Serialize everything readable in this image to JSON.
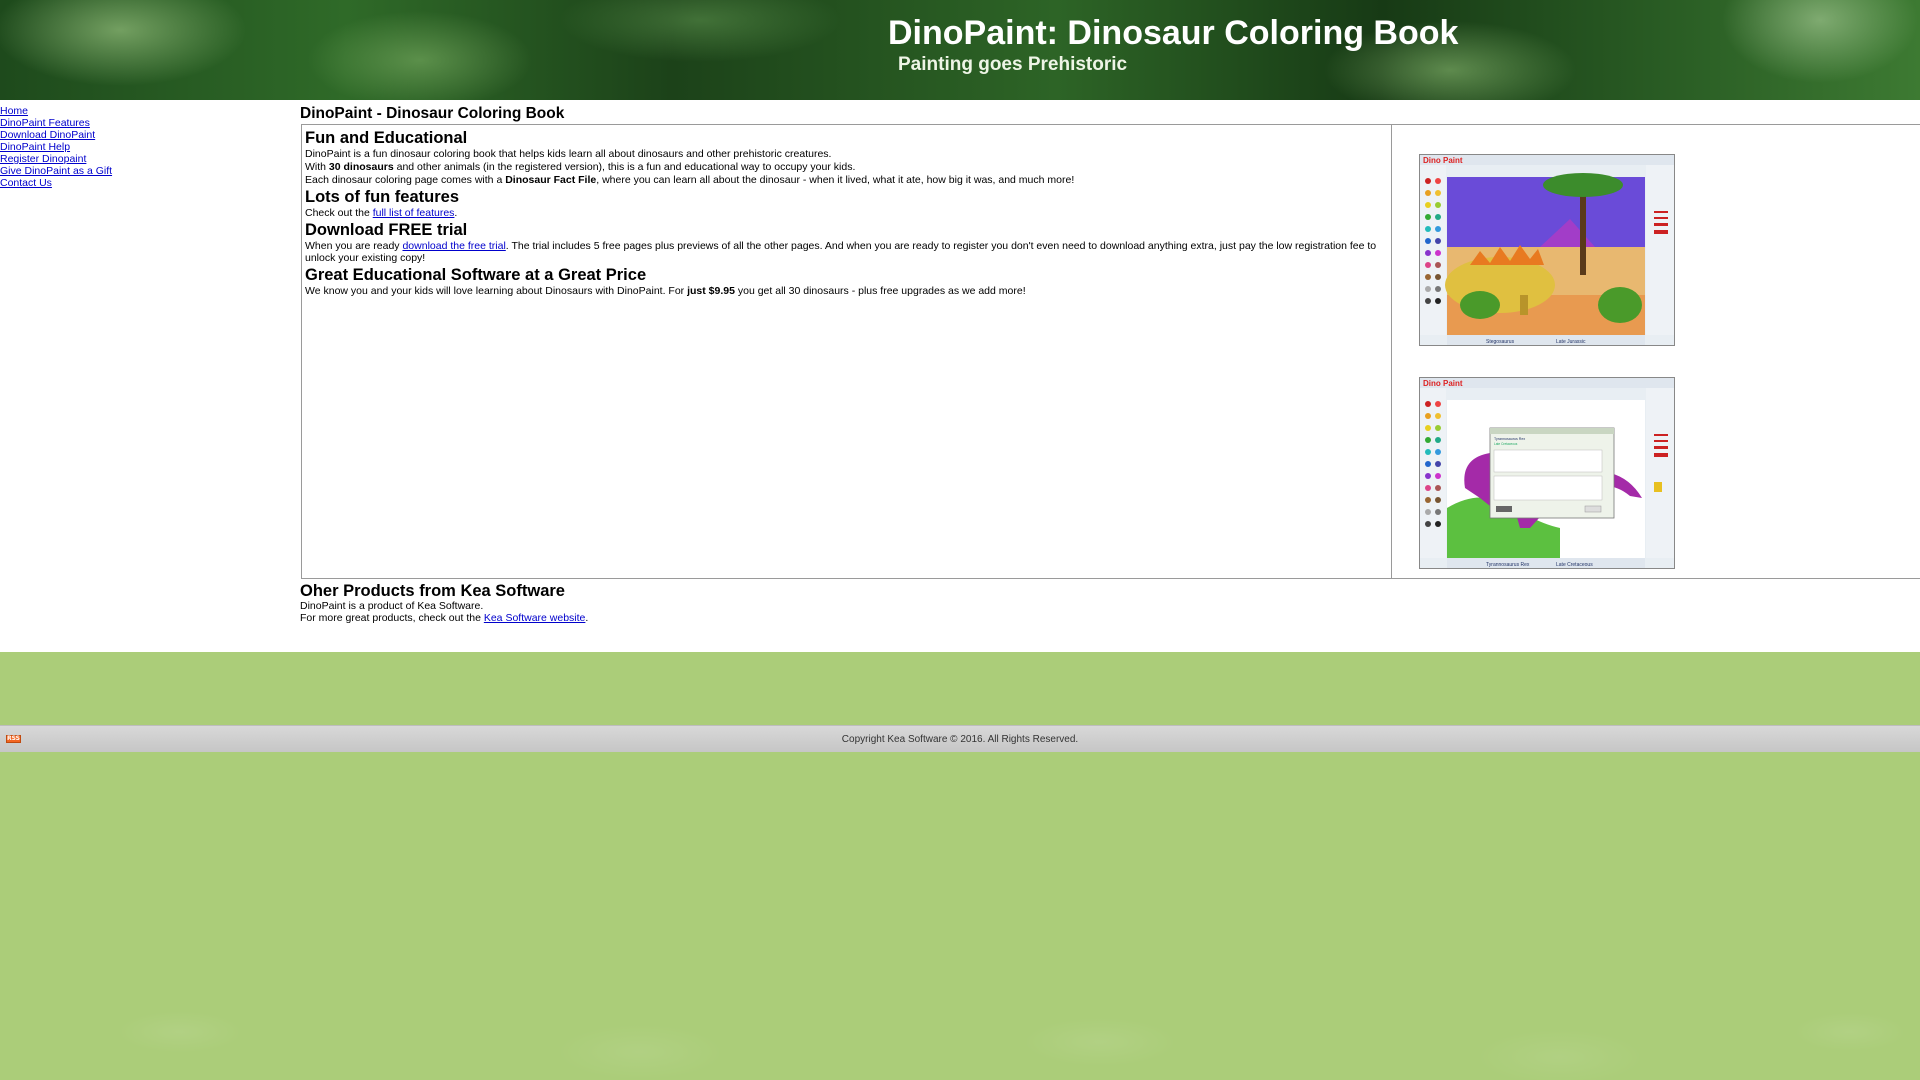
{
  "header": {
    "title": "DinoPaint: Dinosaur Coloring Book",
    "subtitle": "Painting goes Prehistoric"
  },
  "sidebar": {
    "items": [
      {
        "label": "Home"
      },
      {
        "label": "DinoPaint Features"
      },
      {
        "label": "Download DinoPaint"
      },
      {
        "label": "DinoPaint Help"
      },
      {
        "label": "Register Dinopaint"
      },
      {
        "label": "Give DinoPaint as a Gift"
      },
      {
        "label": "Contact Us"
      }
    ]
  },
  "main": {
    "title": "DinoPaint - Dinosaur Coloring Book",
    "sections": [
      {
        "heading": "Fun and Educational",
        "line1": "DinoPaint is a fun dinosaur coloring book that helps kids learn all about dinosaurs and other prehistoric creatures.",
        "line2_pre": "With ",
        "line2_bold": "30 dinosaurs",
        "line2_post": " and other animals (in the registered version), this is a fun and educational way to occupy your kids.",
        "line3_pre": "Each dinosaur coloring page comes with a ",
        "line3_bold": "Dinosaur Fact File",
        "line3_post": ", where you can learn all about the dinosaur - when it lived, what it ate, how big it was, and much more!"
      },
      {
        "heading": "Lots of fun features",
        "text_pre": "Check out the ",
        "link": "full list of features",
        "text_post": "."
      },
      {
        "heading": "Download FREE trial",
        "text_pre": "When you are ready ",
        "link": "download the free trial",
        "text_post": ". The trial includes 5 free pages plus previews of all the other pages. And when you are ready to register you don't even need to download anything extra, just pay the low registration fee to unlock your existing copy!"
      },
      {
        "heading": "Great Educational Software at a Great Price",
        "text_pre": "We know you and your kids will love learning about Dinosaurs with DinoPaint.  For ",
        "bold": "just $9.95",
        "text_post": " you get all 30 dinosaurs - plus free upgrades as we add more!"
      }
    ],
    "screenshots": [
      {
        "logo": "Dino Paint",
        "caption_left": "Stegosaurus",
        "caption_right": "Late Jurassic"
      },
      {
        "logo": "Dino Paint",
        "caption_left": "Tyrannosaurus Rex",
        "caption_right": "Late Cretaceous",
        "fact_title": "Tyrannosaurus Rex",
        "fact_sub": "Late Cretaceous"
      }
    ]
  },
  "other": {
    "title": "Oher Products from Kea Software",
    "line1": "DinoPaint is a product of Kea Software.",
    "line2_pre": "For more great products, check out the ",
    "link": "Kea Software website",
    "line2_post": "."
  },
  "footer": {
    "rss_label": "RSS",
    "copyright": "Copyright Kea Software © 2016. All Rights Reserved."
  },
  "colors": {
    "link": "#0000cc",
    "background_green": "#abcd79",
    "footer_gray": "#cccccc"
  }
}
